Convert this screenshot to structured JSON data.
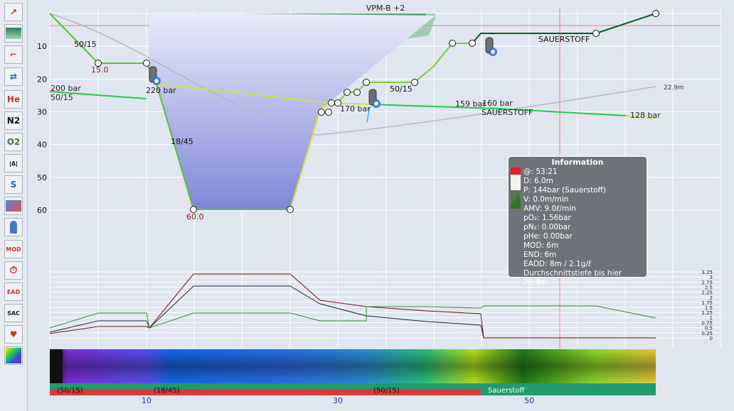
{
  "toolbar": {
    "items": [
      {
        "name": "ascent-icon",
        "glyph": "↗"
      },
      {
        "name": "profile-view-icon",
        "glyph": ""
      },
      {
        "name": "step-profile-icon",
        "glyph": "⌐"
      },
      {
        "name": "gas-change-icon",
        "glyph": "⇄"
      },
      {
        "name": "helium-icon",
        "glyph": "He"
      },
      {
        "name": "nitrogen-icon",
        "glyph": "N2"
      },
      {
        "name": "oxygen-icon",
        "glyph": "O2"
      },
      {
        "name": "delta-icon",
        "glyph": "|Δ|"
      },
      {
        "name": "s-curve-icon",
        "glyph": "S"
      },
      {
        "name": "map-icon",
        "glyph": ""
      },
      {
        "name": "diver-icon",
        "glyph": ""
      },
      {
        "name": "mod-icon",
        "glyph": "MOD"
      },
      {
        "name": "timed-ascent-icon",
        "glyph": ""
      },
      {
        "name": "ead-icon",
        "glyph": "EAD"
      },
      {
        "name": "sac-icon",
        "glyph": "SAC"
      },
      {
        "name": "heart-rate-icon",
        "glyph": "♥"
      },
      {
        "name": "heatmap-icon",
        "glyph": ""
      }
    ]
  },
  "header": {
    "model": "VPM-B +2"
  },
  "depth_ticks": [
    "10",
    "20",
    "30",
    "40",
    "50",
    "60"
  ],
  "time_ticks": [
    "10",
    "30",
    "50"
  ],
  "profile_labels": {
    "gas_50_15_top": "50/15",
    "stop_15": "15.0",
    "pressure_200": "200 bar",
    "gas_50_15_left": "50/15",
    "pressure_220": "220 bar",
    "gas_18_45": "18/45",
    "depth_60": "60.0",
    "pressure_170": "170 bar",
    "gas_50_15_mid": "50/15",
    "pressure_159": "159 bar",
    "pressure_160": "160 bar",
    "sauerstoff_mid": "SAUERSTOFF",
    "sauerstoff_top": "SAUERSTOFF",
    "pressure_128": "128 bar",
    "avg_depth": "22.9m"
  },
  "ppo2_scale": [
    "3.25",
    "3",
    "2.75",
    "2.5",
    "2.25",
    "2",
    "1.75",
    "1.5",
    "1.25",
    "1",
    "0.75",
    "0.5",
    "0.25",
    "0"
  ],
  "gas_bar": [
    {
      "label": "(50/15)",
      "color": "#d63a3a"
    },
    {
      "label": "(18/45)",
      "color": "#d63a3a"
    },
    {
      "label": "(50/15)",
      "color": "#d63a3a"
    },
    {
      "label": "Sauerstoff",
      "color": "#1f9b6e"
    }
  ],
  "info": {
    "title": "Information",
    "rows": [
      "@: 53:21",
      "D: 6.0m",
      "P: 144bar (Sauerstoff)",
      "V: 0.0m/min",
      "AMV: 9.0ℓ/min",
      "pO₂: 1.56bar",
      "pN₂: 0.00bar",
      "pHe: 0.00bar",
      "MOD: 6m",
      "END: 6m",
      "EADD: 8m / 2.1g/ℓ",
      "Durchschnittstiefe bis hier 26.4m"
    ]
  },
  "colors": {
    "background": "#dfe6ef",
    "profile_fill": "#8f99e0",
    "profile_line": "#5bbf3a",
    "deco_ceiling": "#3a9a6a",
    "oxygen_segment": "#0b5a1e",
    "cursor_line": "#f08080",
    "info_bg": "#6f7379"
  }
}
